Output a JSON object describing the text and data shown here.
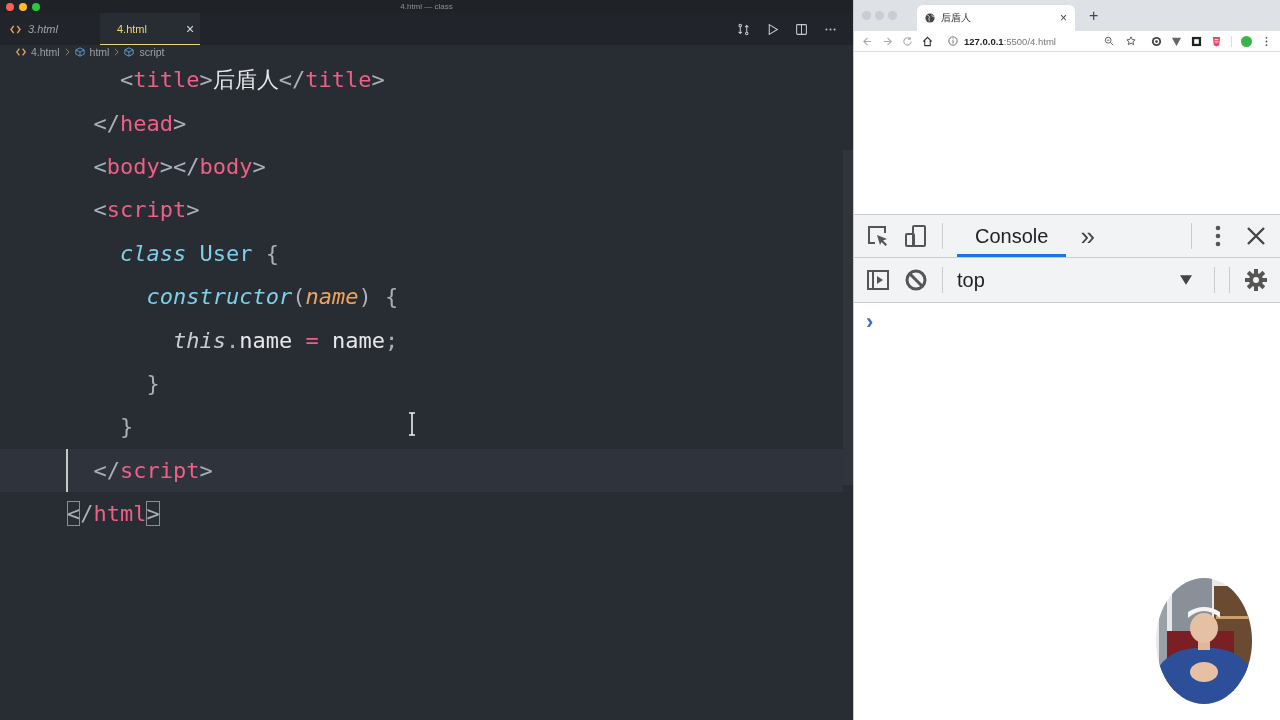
{
  "window": {
    "title": "4.html — class"
  },
  "editor": {
    "tabs": [
      {
        "label": "3.html",
        "selected": false
      },
      {
        "label": "4.html",
        "selected": true,
        "close": "×"
      }
    ],
    "breadcrumb": [
      "4.html",
      "html",
      "script"
    ],
    "lines": [
      {
        "children": [
          {
            "children": [
              {
                "tokens": [
                  {
                    "kind": "punct",
                    "text": "<"
                  },
                  {
                    "kind": "tag",
                    "text": "title"
                  },
                  {
                    "kind": "punct",
                    "text": ">"
                  },
                  {
                    "kind": "text",
                    "text": "后盾人"
                  },
                  {
                    "kind": "punct",
                    "text": "</"
                  },
                  {
                    "kind": "tag",
                    "text": "title"
                  },
                  {
                    "kind": "punct",
                    "text": ">"
                  }
                ]
              }
            ]
          },
          {
            "tokens": [
              {
                "kind": "punct",
                "text": "</"
              },
              {
                "kind": "tag",
                "text": "head"
              },
              {
                "kind": "punct",
                "text": ">"
              }
            ]
          },
          {
            "tokens": [
              {
                "kind": "punct",
                "text": "<"
              },
              {
                "kind": "tag",
                "text": "body"
              },
              {
                "kind": "punct",
                "text": "></"
              },
              {
                "kind": "tag",
                "text": "body"
              },
              {
                "kind": "punct",
                "text": ">"
              }
            ]
          },
          {
            "tokens": [
              {
                "kind": "punct",
                "text": "<"
              },
              {
                "kind": "tag",
                "text": "script"
              },
              {
                "kind": "punct",
                "text": ">"
              }
            ],
            "children": [
              {
                "tokens": [
                  {
                    "kind": "keyword",
                    "text": "class"
                  },
                  {
                    "kind": "classname",
                    "text": " User "
                  },
                  {
                    "kind": "punct",
                    "text": "{"
                  }
                ],
                "children": [
                  {
                    "tokens": [
                      {
                        "kind": "fn",
                        "text": "constructor"
                      },
                      {
                        "kind": "punct",
                        "text": "("
                      },
                      {
                        "kind": "param",
                        "text": "name"
                      },
                      {
                        "kind": "punct",
                        "text": ") {"
                      }
                    ],
                    "children": [
                      {
                        "tokens": [
                          {
                            "kind": "this",
                            "text": "this"
                          },
                          {
                            "kind": "punct",
                            "text": "."
                          },
                          {
                            "kind": "text",
                            "text": "name "
                          },
                          {
                            "kind": "op",
                            "text": "="
                          },
                          {
                            "kind": "text",
                            "text": " name"
                          },
                          {
                            "kind": "punct",
                            "text": ";"
                          }
                        ]
                      }
                    ]
                  },
                  {
                    "tokens": [
                      {
                        "kind": "punct",
                        "text": "}"
                      }
                    ]
                  }
                ]
              },
              {
                "tokens": [
                  {
                    "kind": "punct",
                    "text": "}"
                  }
                ]
              }
            ]
          },
          {
            "tokens": [
              {
                "kind": "punct",
                "text": "</"
              },
              {
                "kind": "tag",
                "text": "script"
              },
              {
                "kind": "punct",
                "text": ">"
              }
            ],
            "current": true
          }
        ]
      },
      {
        "tokens": [
          {
            "kind": "punct",
            "text": "<"
          },
          {
            "kind": "punct",
            "text": "/"
          },
          {
            "kind": "tag",
            "text": "html"
          },
          {
            "kind": "punct",
            "text": ">"
          }
        ],
        "bracket_match": true
      }
    ]
  },
  "browser": {
    "tab": {
      "title": "后盾人",
      "close": "×"
    },
    "new_tab": "+",
    "url": "**127.0.0.1**:5500/4.html",
    "devtools": {
      "tabs": [
        {
          "label": "Console",
          "selected": true
        }
      ],
      "more": "»",
      "context": "top",
      "prompt": "›"
    }
  }
}
